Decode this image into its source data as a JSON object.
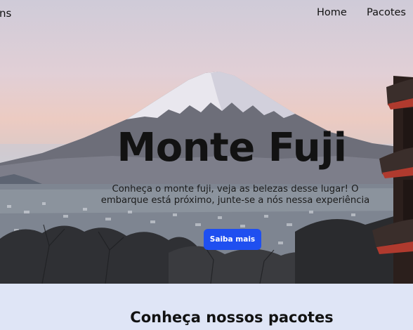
{
  "nav": {
    "brand": "ns",
    "links": [
      "Home",
      "Pacotes"
    ]
  },
  "hero": {
    "title": "Monte Fuji",
    "description": "Conheça o monte fuji, veja as belezas desse lugar! O embarque está próximo, junte-se a nós nessa experiência",
    "cta_label": "Saiba mais"
  },
  "section": {
    "title": "Conheça nossos pacotes"
  },
  "colors": {
    "accent": "#1f4ff0",
    "section_bg": "#dfe5f6",
    "text": "#121212"
  }
}
